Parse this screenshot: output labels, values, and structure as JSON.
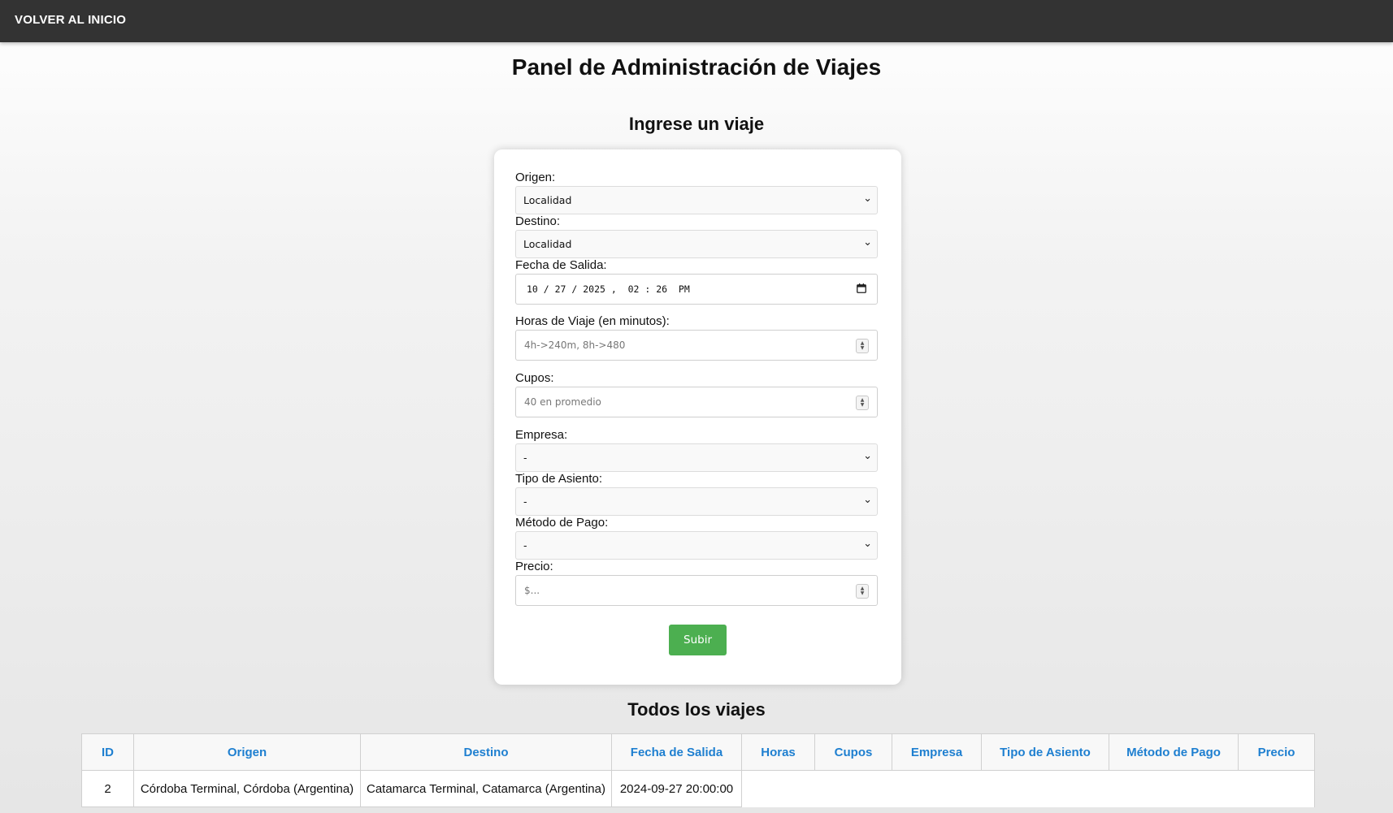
{
  "nav": {
    "home_label": "VOLVER AL INICIO"
  },
  "page": {
    "title": "Panel de Administración de Viajes"
  },
  "form": {
    "heading": "Ingrese un viaje",
    "origen": {
      "label": "Origen:",
      "value": "Localidad"
    },
    "destino": {
      "label": "Destino:",
      "value": "Localidad"
    },
    "fecha": {
      "label": "Fecha de Salida:",
      "value": "10 / 27 / 2025 ,  02 : 26  PM"
    },
    "horas": {
      "label": "Horas de Viaje (en minutos):",
      "placeholder": "4h->240m, 8h->480"
    },
    "cupos": {
      "label": "Cupos:",
      "placeholder": "40 en promedio"
    },
    "empresa": {
      "label": "Empresa:",
      "value": "-"
    },
    "asiento": {
      "label": "Tipo de Asiento:",
      "value": "-"
    },
    "pago": {
      "label": "Método de Pago:",
      "value": "-"
    },
    "precio": {
      "label": "Precio:",
      "placeholder": "$..."
    },
    "submit_label": "Subir"
  },
  "table": {
    "heading": "Todos los viajes",
    "columns": [
      "ID",
      "Origen",
      "Destino",
      "Fecha de Salida",
      "Horas",
      "Cupos",
      "Empresa",
      "Tipo de Asiento",
      "Método de Pago",
      "Precio"
    ],
    "rows": [
      {
        "id": "2",
        "origen": "Córdoba Terminal, Córdoba (Argentina)",
        "destino": "Catamarca Terminal, Catamarca (Argentina)",
        "fecha": "2024-09-27 20:00:00"
      }
    ]
  }
}
